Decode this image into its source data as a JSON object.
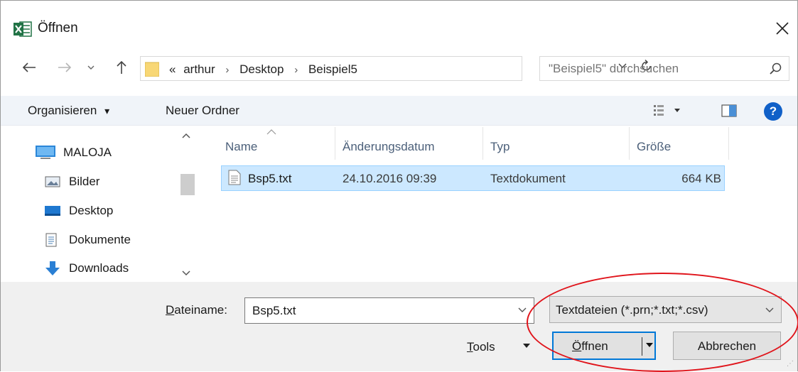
{
  "window": {
    "title": "Öffnen"
  },
  "address": {
    "overflow": "«",
    "crumbs": [
      "arthur",
      "Desktop",
      "Beispiel5"
    ],
    "separator": "›"
  },
  "search": {
    "placeholder": "\"Beispiel5\" durchsuchen"
  },
  "toolbar": {
    "organize_label": "Organisieren",
    "organize_caret": "▾",
    "new_folder_label": "Neuer Ordner",
    "help_label": "?"
  },
  "nav_pane": {
    "items": [
      {
        "label": "MALOJA",
        "icon": "computer-icon"
      },
      {
        "label": "Bilder",
        "icon": "pictures-icon"
      },
      {
        "label": "Desktop",
        "icon": "desktop-icon"
      },
      {
        "label": "Dokumente",
        "icon": "documents-icon"
      },
      {
        "label": "Downloads",
        "icon": "downloads-icon"
      }
    ]
  },
  "file_list": {
    "columns": [
      "Name",
      "Änderungsdatum",
      "Typ",
      "Größe"
    ],
    "rows": [
      {
        "name": "Bsp5.txt",
        "modified": "24.10.2016 09:39",
        "type": "Textdokument",
        "size": "664 KB",
        "selected": true
      }
    ]
  },
  "bottom": {
    "filename_label_accel": "D",
    "filename_label_rest": "ateiname:",
    "filename_value": "Bsp5.txt",
    "filter_value": "Textdateien (*.prn;*.txt;*.csv)",
    "tools_accel": "T",
    "tools_rest": "ools",
    "open_accel": "Ö",
    "open_rest": "ffnen",
    "cancel_label": "Abbrechen"
  },
  "colors": {
    "accent": "#0078d7",
    "selection": "#cce8ff",
    "annotation": "#e0141b",
    "excel_green": "#217346"
  }
}
